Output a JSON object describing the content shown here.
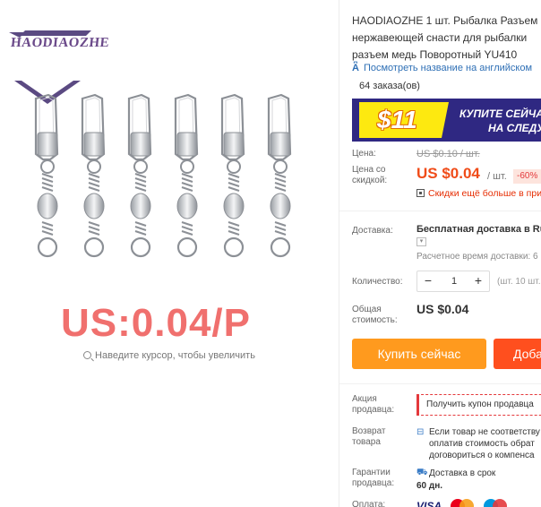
{
  "brand": {
    "logo_text": "HAODIAOZHE"
  },
  "image": {
    "overlay_price": "US:0.04/P",
    "zoom_hint": "Наведите курсор, чтобы увеличить"
  },
  "product": {
    "title_lines": [
      "HAODIAOZHE 1 шт. Рыбалка Разъем",
      "нержавеющей снасти для рыбалки",
      "разъем медь Поворотный YU410"
    ],
    "translate_link": "Посмотреть название на английском",
    "orders": "64 заказа(ов)"
  },
  "banner": {
    "coupon_value": "$11",
    "text_line1": "КУПИТЕ СЕЙЧА",
    "text_line2": "НА СЛЕДУ"
  },
  "pricing": {
    "price_label": "Цена:",
    "old_price": "US $0.10 / шт.",
    "discount_label": "Цена со скидкой:",
    "new_price": "US $0.04",
    "per_unit": "/ шт.",
    "discount_badge": "-60%",
    "more_discounts": "Скидки ещё больше в при"
  },
  "shipping": {
    "label": "Доставка:",
    "value": "Бесплатная доставка в Russ",
    "dropdown_icon": "chevron-down-icon",
    "time": "Расчетное время доставки: 6"
  },
  "quantity": {
    "label": "Количество:",
    "minus": "−",
    "value": "1",
    "plus": "+",
    "available": "(шт. 10 шт. д"
  },
  "total": {
    "label": "Общая стоимость:",
    "value": "US $0.04"
  },
  "actions": {
    "buy_now": "Купить сейчас",
    "add_to_cart": "Доба"
  },
  "seller_promo": {
    "label": "Акция продавца:",
    "coupon": "Получить купон продавца"
  },
  "returns": {
    "label": "Возврат товара",
    "lines": [
      "Если товар не соответству",
      "оплатив стоимость обрат",
      "договориться о компенса"
    ]
  },
  "guarantee": {
    "label": "Гарантии продавца:",
    "line1": "Доставка в срок",
    "line2": "60 дн."
  },
  "payment": {
    "label": "Оплата:",
    "visa": "VISA"
  },
  "colors": {
    "orange": "#ff9a1e",
    "red_orange": "#ff4f1e",
    "price_red": "#f04c19",
    "overlay_price": "#f0706e",
    "banner_bg": "#2f2882",
    "banner_coupon": "#fde910",
    "link_blue": "#2e6fb5"
  }
}
